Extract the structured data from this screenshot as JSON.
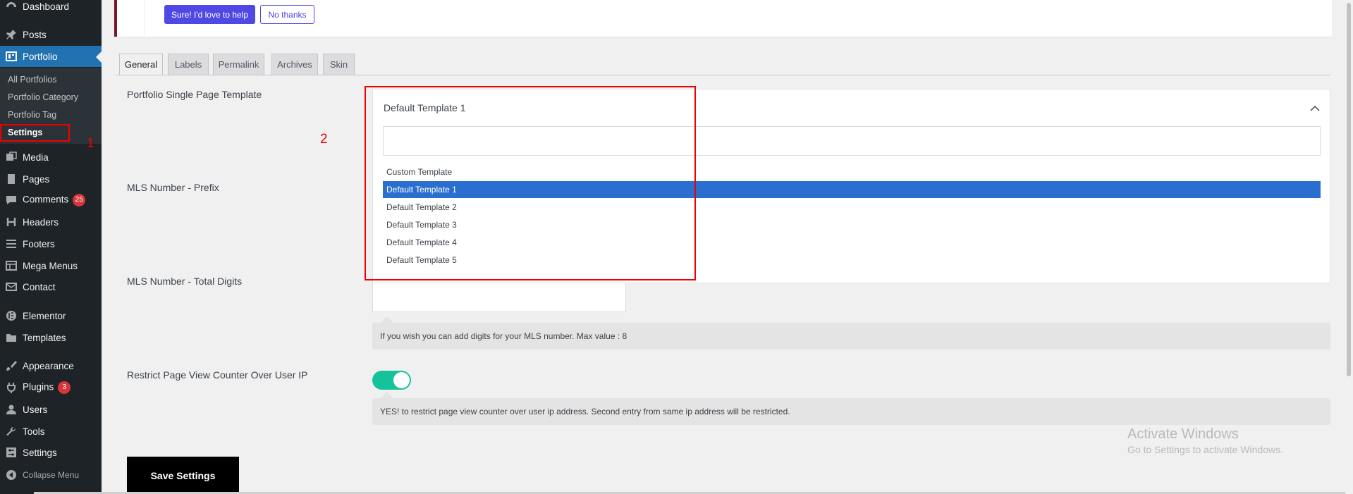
{
  "sidebar": {
    "dashboard": "Dashboard",
    "posts": "Posts",
    "portfolio": "Portfolio",
    "submenu": [
      "All Portfolios",
      "Portfolio Category",
      "Portfolio Tag",
      "Settings"
    ],
    "media": "Media",
    "pages": "Pages",
    "comments": "Comments",
    "comments_count": "25",
    "headers": "Headers",
    "footers": "Footers",
    "mega_menus": "Mega Menus",
    "contact": "Contact",
    "elementor": "Elementor",
    "templates": "Templates",
    "appearance": "Appearance",
    "plugins": "Plugins",
    "plugins_count": "3",
    "users": "Users",
    "tools": "Tools",
    "settings": "Settings",
    "collapse": "Collapse Menu"
  },
  "notice": {
    "primary_button": "Sure! I'd love to help",
    "secondary_button": "No thanks"
  },
  "tabs": [
    "General",
    "Labels",
    "Permalink",
    "Archives",
    "Skin"
  ],
  "form": {
    "template_label": "Portfolio Single Page Template",
    "template_value": "Default Template 1",
    "search_value": "",
    "options": [
      "Custom Template",
      "Default Template 1",
      "Default Template 2",
      "Default Template 3",
      "Default Template 4",
      "Default Template 5"
    ],
    "selected_option": "Default Template 1",
    "mls_prefix_label": "MLS Number - Prefix",
    "mls_digits_label": "MLS Number - Total Digits",
    "mls_digits_help": "If you wish you can add digits for your MLS number. Max value : 8",
    "restrict_label": "Restrict Page View Counter Over User IP",
    "restrict_enabled": true,
    "restrict_help": "YES! to restrict page view counter over user ip address. Second entry from same ip address will be restricted.",
    "save_button": "Save Settings"
  },
  "annotations": {
    "one": "1",
    "two": "2",
    "color": "#ee0000"
  },
  "watermark": {
    "title": "Activate Windows",
    "subtitle": "Go to Settings to activate Windows."
  },
  "colors": {
    "sidebar": "#1d2327",
    "active": "#2271b1",
    "accent": "#5048e5",
    "toggle": "#15c39a",
    "selected_option": "#2a6fcf"
  }
}
